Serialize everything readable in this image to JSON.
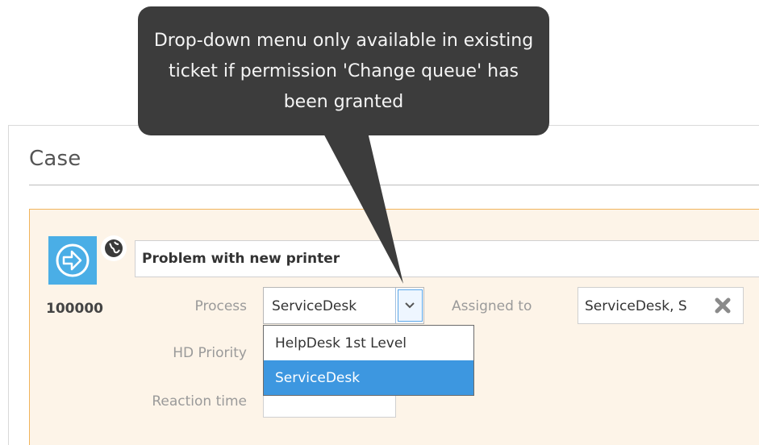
{
  "callout": {
    "text": "Drop-down menu only available in existing ticket if permission 'Change queue' has been granted"
  },
  "panel": {
    "title": "Case"
  },
  "ticket": {
    "number": "100000",
    "subject": "Problem with new printer",
    "icon": "arrow-right-circle-icon",
    "badge_icon": "globe-icon"
  },
  "fields": {
    "process_label": "Process",
    "process_value": "ServiceDesk",
    "hd_priority_label": "HD Priority",
    "reaction_time_label": "Reaction time",
    "assigned_to_label": "Assigned to",
    "assigned_to_value": "ServiceDesk, S"
  },
  "dropdown": {
    "options": [
      {
        "label": "HelpDesk 1st Level",
        "selected": false
      },
      {
        "label": "ServiceDesk",
        "selected": true
      }
    ]
  },
  "colors": {
    "accent": "#4aaee6",
    "selected_bg": "#3d97e0",
    "ticket_border": "#f1b45c",
    "ticket_bg": "#fdf4e8",
    "callout_bg": "#3c3c3c"
  }
}
